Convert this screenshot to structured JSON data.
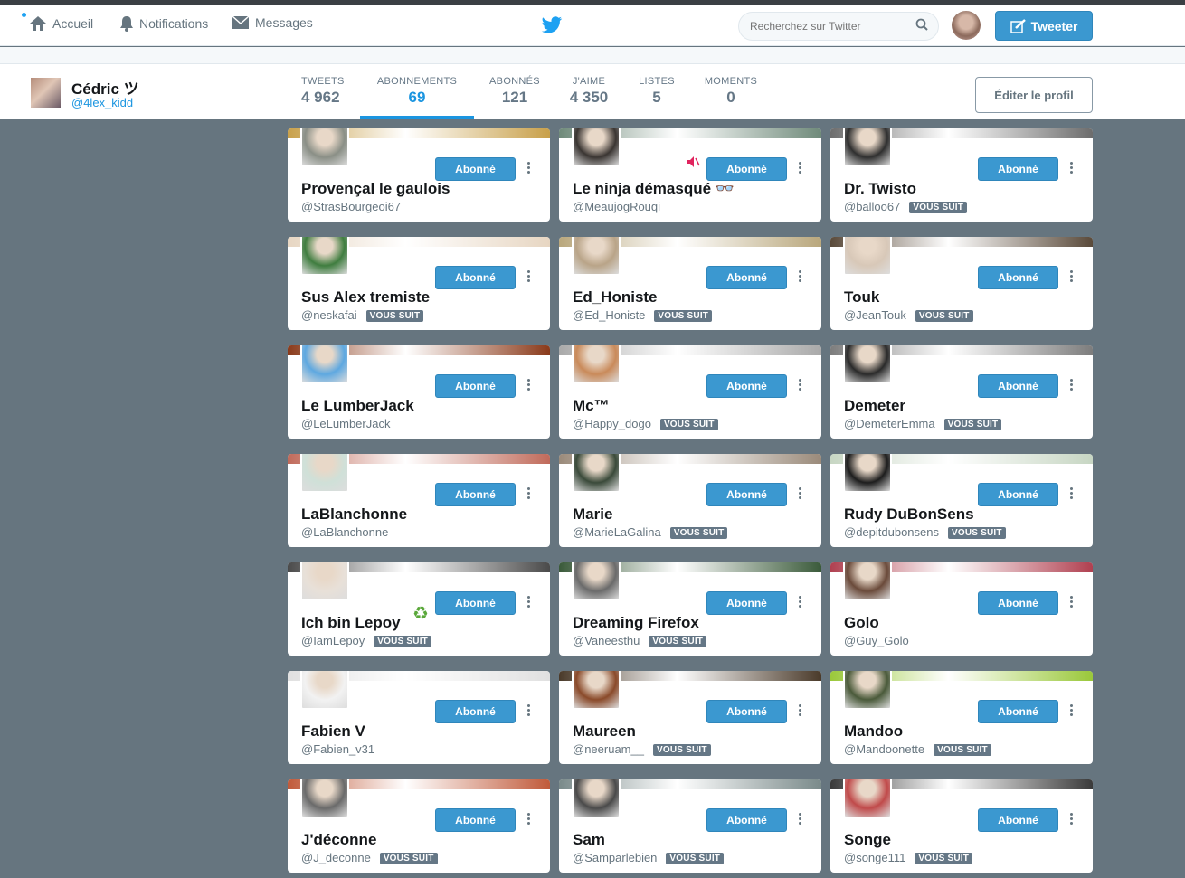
{
  "nav": {
    "home": "Accueil",
    "notifications": "Notifications",
    "messages": "Messages",
    "search_placeholder": "Recherchez sur Twitter",
    "tweet_button": "Tweeter"
  },
  "profile": {
    "name": "Cédric ツ",
    "handle": "@4lex_kidd",
    "edit_button": "Éditer le profil",
    "stats": [
      {
        "label": "TWEETS",
        "value": "4 962"
      },
      {
        "label": "ABONNEMENTS",
        "value": "69"
      },
      {
        "label": "ABONNÉS",
        "value": "121"
      },
      {
        "label": "J'AIME",
        "value": "4 350"
      },
      {
        "label": "LISTES",
        "value": "5"
      },
      {
        "label": "MOMENTS",
        "value": "0"
      }
    ]
  },
  "labels": {
    "following": "Abonné",
    "follows_you": "VOUS SUIT"
  },
  "cards": [
    {
      "name": "Provençal le gaulois",
      "handle": "@StrasBourgeoi67",
      "follows_you": false,
      "banner": "#c8a04a",
      "avatar": "#8a8f86"
    },
    {
      "name": "Le ninja démasqué 👓",
      "handle": "@MeaujogRouqi",
      "follows_you": false,
      "banner": "#6f8a7a",
      "avatar": "#3a3532",
      "muted": true
    },
    {
      "name": "Dr. Twisto",
      "handle": "@balloo67",
      "follows_you": true,
      "banner": "#6d6d6d",
      "avatar": "#2f2f2f"
    },
    {
      "name": "Sus Alex tremiste",
      "handle": "@neskafai",
      "follows_you": true,
      "banner": "#e7d6c2",
      "avatar": "#3f7d3f"
    },
    {
      "name": "Ed_Honiste",
      "handle": "@Ed_Honiste",
      "follows_you": true,
      "banner": "#b9a77c",
      "avatar": "#b9a488"
    },
    {
      "name": "Touk",
      "handle": "@JeanTouk",
      "follows_you": true,
      "banner": "#5a4a3a",
      "avatar": "#d8c8b8"
    },
    {
      "name": "Le LumberJack",
      "handle": "@LeLumberJack",
      "follows_you": false,
      "banner": "#8a3a1a",
      "avatar": "#5ea8e0"
    },
    {
      "name": "Mc™",
      "handle": "@Happy_dogo",
      "follows_you": true,
      "banner": "#a9a9a9",
      "avatar": "#c98a5a"
    },
    {
      "name": "Demeter",
      "handle": "@DemeterEmma",
      "follows_you": true,
      "banner": "#7d7d7d",
      "avatar": "#2a2a2a"
    },
    {
      "name": "LaBlanchonne",
      "handle": "@LaBlanchonne",
      "follows_you": false,
      "banner": "#c06a5a",
      "avatar": "#cfe0d8"
    },
    {
      "name": "Marie",
      "handle": "@MarieLaGalina",
      "follows_you": true,
      "banner": "#9a8a7a",
      "avatar": "#3a4a3a"
    },
    {
      "name": "Rudy DuBonSens",
      "handle": "@depitdubonsens",
      "follows_you": true,
      "banner": "#c7d6c3",
      "avatar": "#1d1d1d"
    },
    {
      "name": "Ich bin Lepoy",
      "handle": "@IamLepoy",
      "follows_you": true,
      "banner": "#4a4a4a",
      "avatar": "#e8e0d8"
    },
    {
      "name": "Dreaming Firefox",
      "handle": "@Vaneesthu",
      "follows_you": true,
      "banner": "#3a5a3a",
      "avatar": "#6a6a6a"
    },
    {
      "name": "Golo",
      "handle": "@Guy_Golo",
      "follows_you": false,
      "banner": "#b04050",
      "avatar": "#6a4a3a"
    },
    {
      "name": "Fabien V",
      "handle": "@Fabien_v31",
      "follows_you": false,
      "banner": "#e0e0e0",
      "avatar": "#f2f2f2"
    },
    {
      "name": "Maureen",
      "handle": "@neeruam__",
      "follows_you": true,
      "banner": "#4a3a2a",
      "avatar": "#8a4a2a"
    },
    {
      "name": "Mandoo",
      "handle": "@Mandoonette",
      "follows_you": true,
      "banner": "#9ac83a",
      "avatar": "#4a5a3a"
    },
    {
      "name": "J'déconne",
      "handle": "@J_deconne",
      "follows_you": true,
      "banner": "#c05a3a",
      "avatar": "#6a6a6a"
    },
    {
      "name": "Sam",
      "handle": "@Samparlebien",
      "follows_you": true,
      "banner": "#7a8a8a",
      "avatar": "#4a4a4a"
    },
    {
      "name": "Songe",
      "handle": "@songe111",
      "follows_you": true,
      "banner": "#3a3a3a",
      "avatar": "#c04a4a"
    }
  ]
}
